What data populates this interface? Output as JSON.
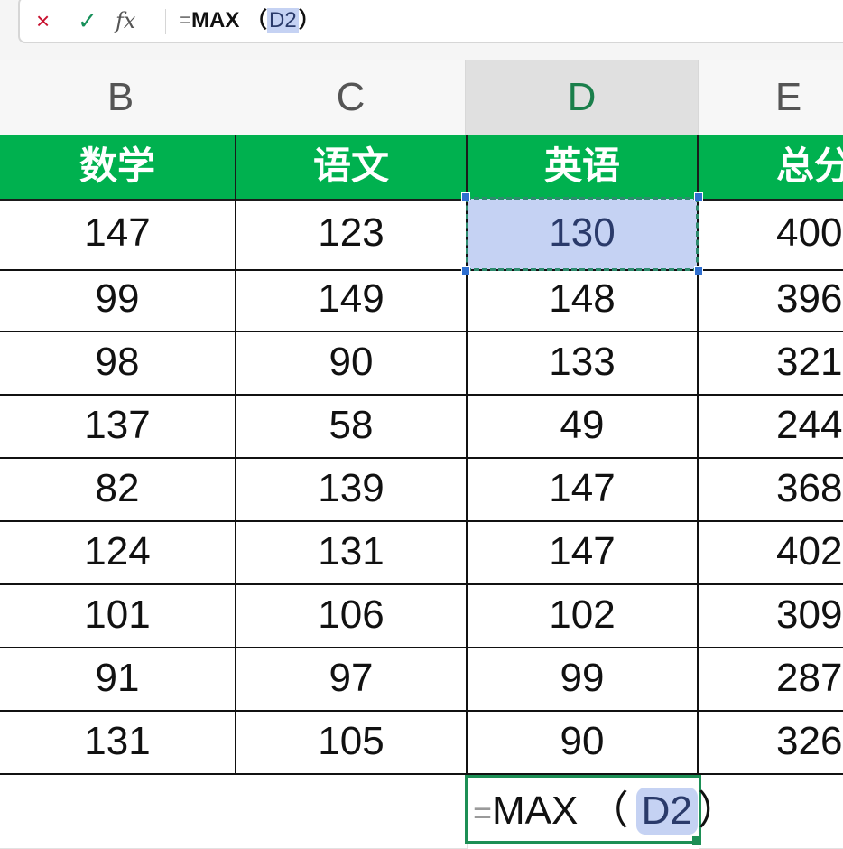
{
  "formula_bar": {
    "cancel_icon": "×",
    "confirm_icon": "✓",
    "fx_label": "fx",
    "formula_eq": "=",
    "formula_name": "MAX （",
    "formula_ref": "D2",
    "formula_close": "）"
  },
  "columns": [
    "B",
    "C",
    "D",
    "E"
  ],
  "selected_column": "D",
  "header_row": [
    "数学",
    "语文",
    "英语",
    "总分"
  ],
  "rows": [
    [
      "147",
      "123",
      "130",
      "400"
    ],
    [
      "99",
      "149",
      "148",
      "396"
    ],
    [
      "98",
      "90",
      "133",
      "321"
    ],
    [
      "137",
      "58",
      "49",
      "244"
    ],
    [
      "82",
      "139",
      "147",
      "368"
    ],
    [
      "124",
      "131",
      "147",
      "402"
    ],
    [
      "101",
      "106",
      "102",
      "309"
    ],
    [
      "91",
      "97",
      "99",
      "287"
    ],
    [
      "131",
      "105",
      "90",
      "326"
    ]
  ],
  "edit_cell": {
    "eq": "=",
    "name": "MAX （",
    "ref": "D2",
    "close": "）"
  },
  "colors": {
    "header_green": "#00b14f",
    "selection_blue": "#c5d2f3",
    "active_border": "#1c8f55"
  }
}
